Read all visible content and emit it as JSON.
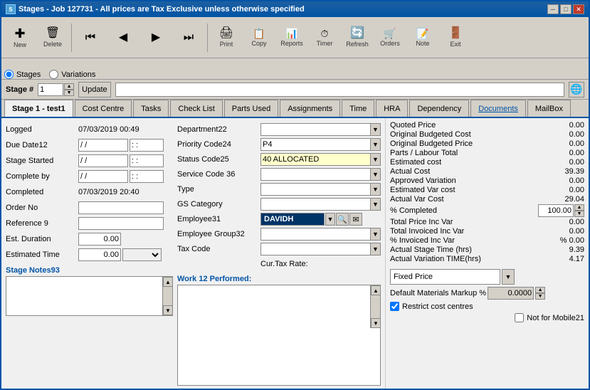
{
  "window": {
    "title": "Stages - Job 127731 - All prices are Tax Exclusive unless otherwise specified",
    "icon": "S"
  },
  "toolbar": {
    "buttons": [
      {
        "id": "new",
        "icon": "✚",
        "label": "New"
      },
      {
        "id": "delete",
        "icon": "🗑",
        "label": "Delete"
      },
      {
        "id": "first",
        "icon": "⏮",
        "label": ""
      },
      {
        "id": "prev",
        "icon": "◀",
        "label": ""
      },
      {
        "id": "next",
        "icon": "▶",
        "label": ""
      },
      {
        "id": "last",
        "icon": "⏭",
        "label": ""
      },
      {
        "id": "print",
        "icon": "🖨",
        "label": "Print"
      },
      {
        "id": "copy",
        "icon": "📋",
        "label": "Copy"
      },
      {
        "id": "reports",
        "icon": "📊",
        "label": "Reports"
      },
      {
        "id": "timer",
        "icon": "⏱",
        "label": "Timer"
      },
      {
        "id": "refresh",
        "icon": "🔄",
        "label": "Refresh"
      },
      {
        "id": "orders",
        "icon": "🛒",
        "label": "Orders"
      },
      {
        "id": "note",
        "icon": "📝",
        "label": "Note"
      },
      {
        "id": "exit",
        "icon": "🚪",
        "label": "Exit"
      }
    ]
  },
  "tabs_row1": {
    "stages_label": "Stages",
    "variations_label": "Variations"
  },
  "stage": {
    "label": "Stage #",
    "number": "1",
    "title_input": "test1",
    "stage_label": "Stage 1 - test1"
  },
  "tabs_row2": {
    "tabs": [
      {
        "id": "cost-centre",
        "label": "Cost Centre",
        "active": false
      },
      {
        "id": "tasks",
        "label": "Tasks",
        "active": false
      },
      {
        "id": "check-list",
        "label": "Check List",
        "active": false
      },
      {
        "id": "parts-used",
        "label": "Parts Used",
        "active": false
      },
      {
        "id": "assignments",
        "label": "Assignments",
        "active": false
      },
      {
        "id": "time",
        "label": "Time",
        "active": false
      },
      {
        "id": "hra",
        "label": "HRA",
        "active": false
      },
      {
        "id": "dependency",
        "label": "Dependency",
        "active": false
      },
      {
        "id": "documents",
        "label": "Documents",
        "active": false
      },
      {
        "id": "mailbox",
        "label": "MailBox",
        "active": false
      }
    ]
  },
  "left_fields": {
    "logged_label": "Logged",
    "logged_value": "07/03/2019 00:49",
    "due_date_label": "Due Date12",
    "due_date_value": "/ /",
    "due_time_value": ": :",
    "stage_started_label": "Stage Started",
    "stage_started_date": "/ /",
    "stage_started_time": ": :",
    "complete_by_label": "Complete by",
    "complete_by_date": "/ /",
    "complete_by_time": ": :",
    "completed_label": "Completed",
    "completed_value": "07/03/2019 20:40",
    "order_no_label": "Order No",
    "order_no_value": "",
    "reference_label": "Reference 9",
    "reference_value": "",
    "est_duration_label": "Est. Duration",
    "est_duration_value": "0.00",
    "est_time_label": "Estimated Time",
    "est_time_value": "0.00"
  },
  "form_fields": {
    "department_label": "Department22",
    "department_value": "",
    "priority_label": "Priority Code24",
    "priority_value": "P4",
    "status_label": "Status Code25",
    "status_value": "40 ALLOCATED",
    "service_label": "Service Code 36",
    "service_value": "",
    "type_label": "Type",
    "type_value": "",
    "gs_category_label": "GS Category",
    "gs_category_value": "",
    "employee_label": "Employee31",
    "employee_value": "DAVIDH",
    "employee_group_label": "Employee Group32",
    "employee_group_value": "",
    "tax_code_label": "Tax Code",
    "tax_code_value": "",
    "cur_tax_label": "Cur.Tax Rate:"
  },
  "right_panel": {
    "quoted_price_label": "Quoted Price",
    "quoted_price_value": "0.00",
    "original_budgeted_cost_label": "Original Budgeted Cost",
    "original_budgeted_cost_value": "0.00",
    "original_budgeted_price_label": "Original Budgeted Price",
    "original_budgeted_price_value": "0.00",
    "parts_labour_label": "Parts / Labour Total",
    "parts_labour_value": "0.00",
    "estimated_cost_label": "Estimated cost",
    "estimated_cost_value": "0.00",
    "actual_cost_label": "Actual Cost",
    "actual_cost_value": "39.39",
    "approved_variation_label": "Approved Variation",
    "approved_variation_value": "0.00",
    "estimated_var_cost_label": "Estimated Var cost",
    "estimated_var_cost_value": "0.00",
    "actual_var_cost_label": "Actual Var Cost",
    "actual_var_cost_value": "29.04",
    "pct_completed_label": "% Completed",
    "pct_completed_value": "100.00",
    "total_price_inc_var_label": "Total Price Inc Var",
    "total_price_inc_var_value": "0.00",
    "total_invoiced_inc_var_label": "Total Invoiced Inc Var",
    "total_invoiced_inc_var_value": "0.00",
    "pct_invoiced_inc_var_label": "% Invoiced Inc Var",
    "pct_invoiced_inc_var_value": "% 0.00",
    "actual_stage_time_label": "Actual Stage Time (hrs)",
    "actual_stage_time_value": "9.39",
    "actual_variation_time_label": "Actual Variation TIME(hrs)",
    "actual_variation_time_value": "4.17",
    "fixed_price_label": "Fixed Price",
    "default_materials_label": "Default Materials Markup %",
    "default_materials_value": "0.0000",
    "restrict_cost_label": "Restrict cost centres",
    "not_for_mobile_label": "Not for Mobile21"
  },
  "bottom": {
    "stage_notes_label": "Stage Notes93",
    "work_performed_label": "Work 12 Performed:"
  }
}
